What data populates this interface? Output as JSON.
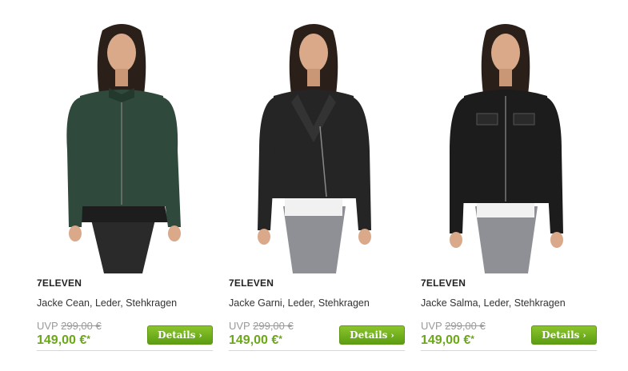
{
  "products": [
    {
      "brand": "7ELEVEN",
      "title": "Jacke Cean, Leder, Stehkragen",
      "uvp_label": "UVP",
      "old_price": "299,00 €",
      "price": "149,00 €",
      "price_suffix": "*",
      "details_label": "Details",
      "details_icon": "›",
      "jacket_color": "#2f4a3c"
    },
    {
      "brand": "7ELEVEN",
      "title": "Jacke Garni, Leder, Stehkragen",
      "uvp_label": "UVP",
      "old_price": "299,00 €",
      "price": "149,00 €",
      "price_suffix": "*",
      "details_label": "Details",
      "details_icon": "›",
      "jacket_color": "#252525"
    },
    {
      "brand": "7ELEVEN",
      "title": "Jacke Salma, Leder, Stehkragen",
      "uvp_label": "UVP",
      "old_price": "299,00 €",
      "price": "149,00 €",
      "price_suffix": "*",
      "details_label": "Details",
      "details_icon": "›",
      "jacket_color": "#1c1c1c"
    }
  ],
  "colors": {
    "price": "#6ca718",
    "button": "#6aaa1a",
    "old_price": "#9a9a9a"
  }
}
